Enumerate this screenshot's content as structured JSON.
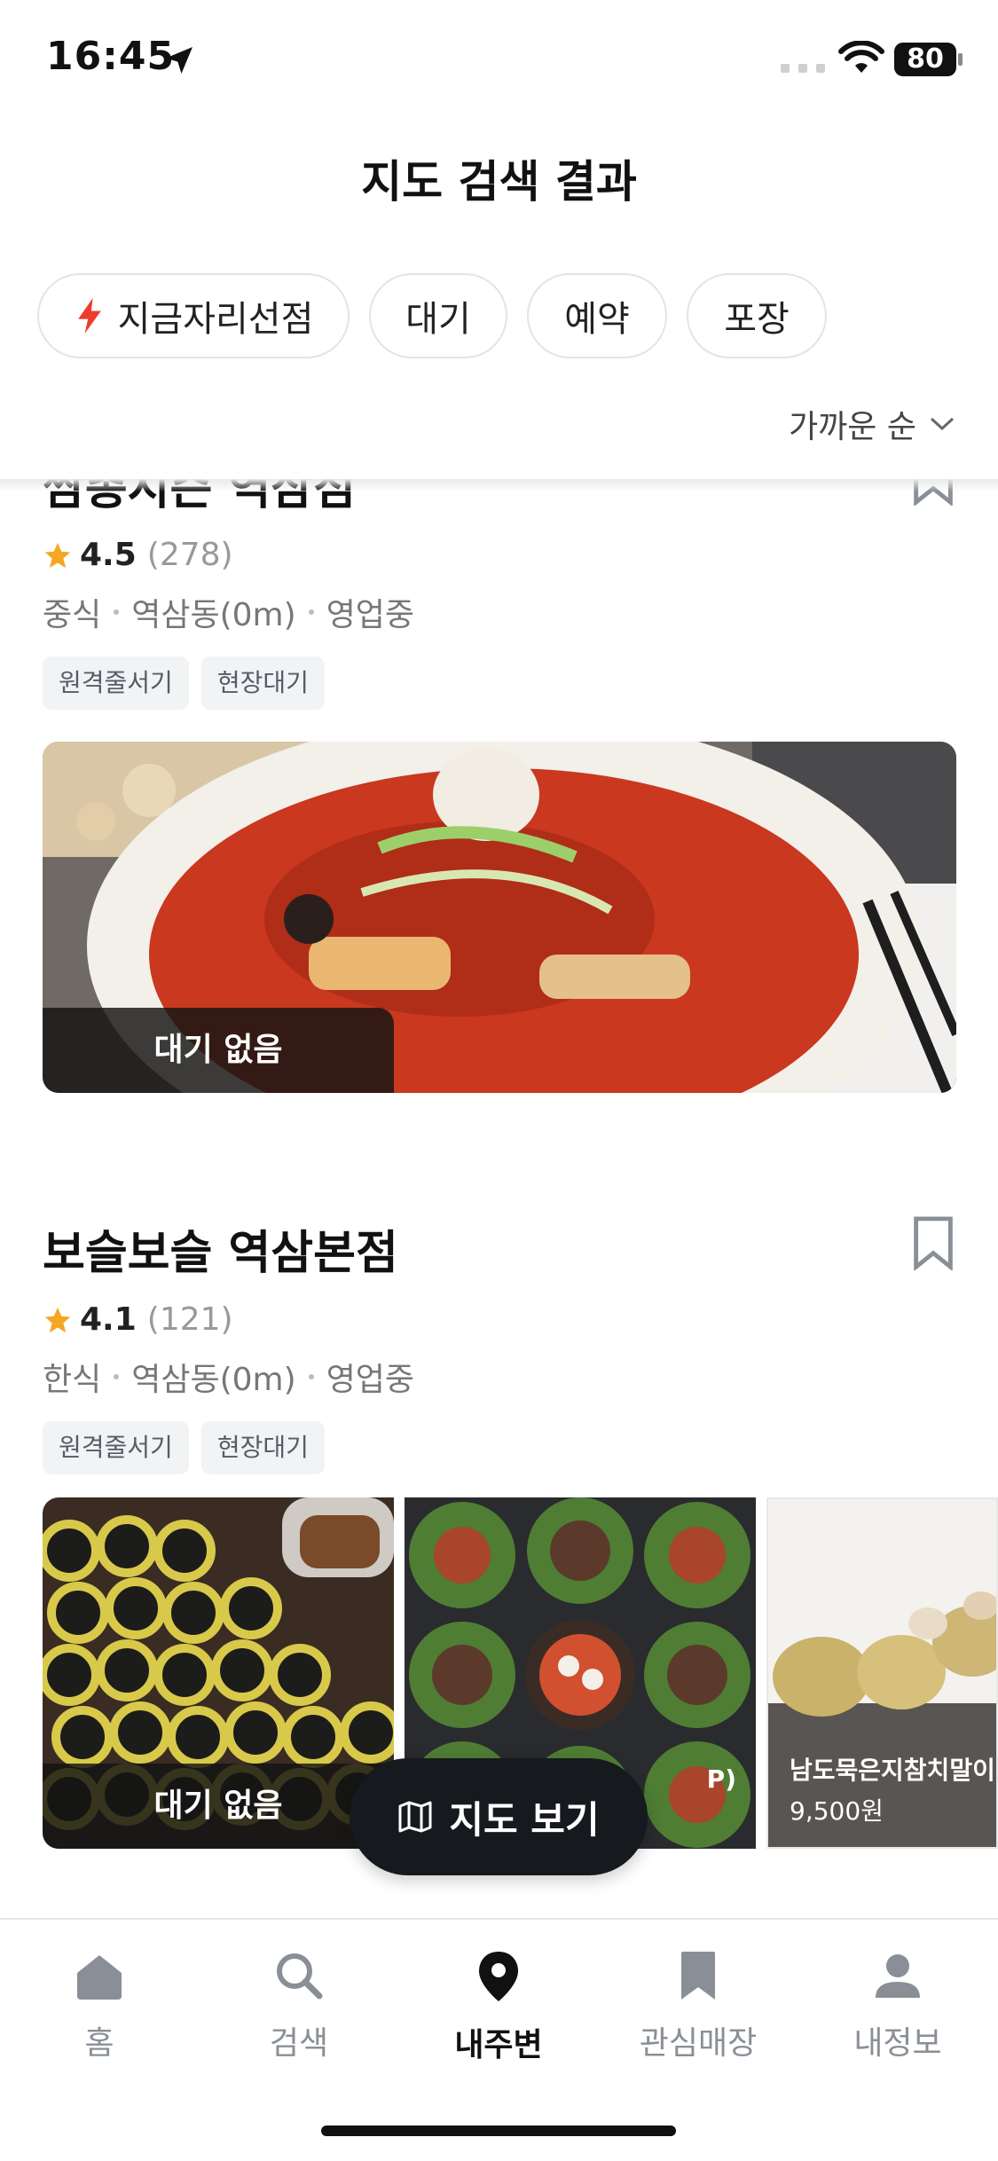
{
  "status_bar": {
    "time": "16:45",
    "battery": "80"
  },
  "header": {
    "title": "지도 검색 결과"
  },
  "filters": {
    "chips": [
      {
        "label": "지금자리선점",
        "icon": "bolt-icon",
        "accent": "#ef3b2d"
      },
      {
        "label": "대기"
      },
      {
        "label": "예약"
      },
      {
        "label": "포장"
      }
    ]
  },
  "sort": {
    "label": "가까운 순"
  },
  "stores": [
    {
      "name": "쌈총시즌 역삼점",
      "rating": "4.5",
      "reviews": "(278)",
      "category": "중식",
      "location": "역삼동(0m)",
      "status": "영업중",
      "tags": [
        "원격줄서기",
        "현장대기"
      ],
      "wait_badge": "대기 없음"
    },
    {
      "name": "보슬보슬 역삼본점",
      "rating": "4.1",
      "reviews": "(121)",
      "category": "한식",
      "location": "역삼동(0m)",
      "status": "영업중",
      "tags": [
        "원격줄서기",
        "현장대기"
      ],
      "wait_badge": "대기 없음",
      "menu": [
        {
          "caption": "P)"
        },
        {
          "name": "남도묵은지참치말이",
          "price": "9,500원"
        }
      ]
    }
  ],
  "map_button": {
    "label": "지도 보기"
  },
  "tabbar": {
    "items": [
      {
        "label": "홈",
        "icon": "home-icon"
      },
      {
        "label": "검색",
        "icon": "search-icon"
      },
      {
        "label": "내주변",
        "icon": "location-pin-icon",
        "active": true
      },
      {
        "label": "관심매장",
        "icon": "bookmark-icon"
      },
      {
        "label": "내정보",
        "icon": "person-icon"
      }
    ]
  },
  "colors": {
    "star": "#f5a623",
    "accent": "#ef3b2d",
    "dark": "#16191d"
  }
}
